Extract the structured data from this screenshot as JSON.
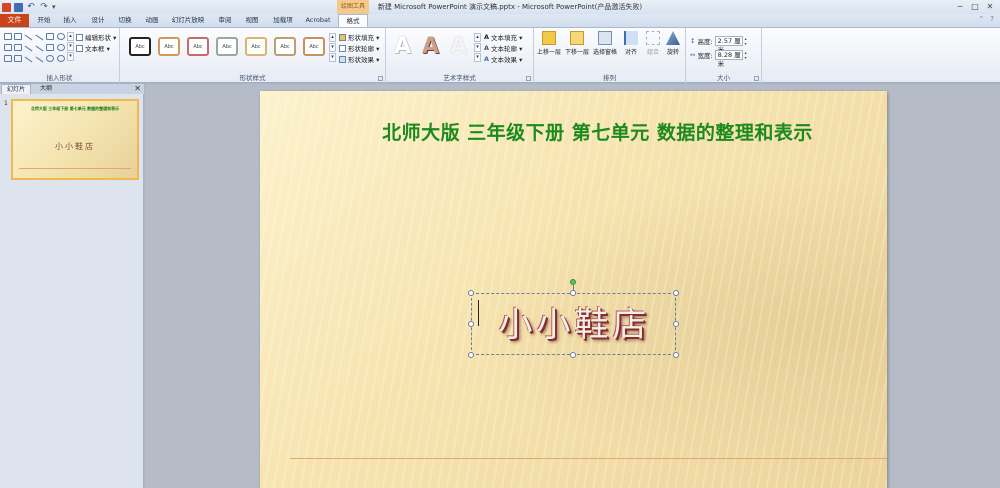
{
  "window": {
    "title": "新建 Microsoft PowerPoint 演示文稿.pptx  -  Microsoft PowerPoint(产品激活失败)",
    "context_tab_header": "绘图工具"
  },
  "tabs": {
    "file": "文件",
    "items": [
      "开始",
      "插入",
      "设计",
      "切换",
      "动画",
      "幻灯片放映",
      "审阅",
      "视图",
      "加载项",
      "Acrobat",
      "格式"
    ],
    "active": "格式"
  },
  "ribbon": {
    "insert_shapes": {
      "label": "插入形状",
      "edit_shape": "编辑形状 ▾",
      "text_box": "文本框 ▾"
    },
    "shape_styles": {
      "label": "形状样式",
      "gallery_sample": "Abc",
      "fill": "形状填充 ▾",
      "outline": "形状轮廓 ▾",
      "effects": "形状效果 ▾"
    },
    "wordart_styles": {
      "label": "艺术字样式",
      "sample": "A",
      "text_fill": "文本填充 ▾",
      "text_outline": "文本轮廓 ▾",
      "text_effects": "文本效果 ▾"
    },
    "arrange": {
      "label": "排列",
      "bring_forward": "上移一层",
      "send_backward": "下移一层",
      "selection_pane": "选择窗格",
      "align": "对齐",
      "group": "组合",
      "rotate": "旋转"
    },
    "size": {
      "label": "大小",
      "height_label": "高度:",
      "height_value": "2.57 厘米",
      "width_label": "宽度:",
      "width_value": "8.28 厘米"
    }
  },
  "panel": {
    "tab_slides": "幻灯片",
    "tab_outline": "大纲",
    "close": "✕",
    "slide_number": "1"
  },
  "slide": {
    "title": "北师大版  三年级下册  第七单元  数据的整理和表示",
    "textbox_text": "小小鞋店"
  },
  "thumbnail": {
    "title": "北师大版  三年级下册  第七单元  数据的整理和表示",
    "subtitle": "小小鞋店"
  },
  "colors": {
    "file_tab": "#c9441b",
    "title_green": "#1d8a1d",
    "thumb_border": "#f2b84a"
  }
}
